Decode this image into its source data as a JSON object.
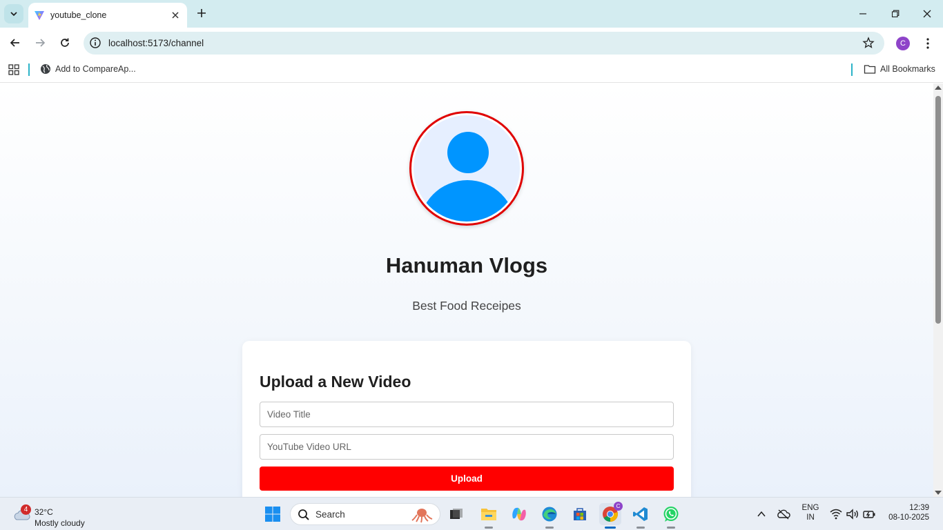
{
  "browser": {
    "tab_title": "youtube_clone",
    "url": "localhost:5173/channel",
    "profile_initial": "C",
    "bookmark_item": "Add to CompareAp...",
    "all_bookmarks": "All Bookmarks"
  },
  "channel": {
    "name": "Hanuman Vlogs",
    "description": "Best Food Receipes"
  },
  "upload_form": {
    "heading": "Upload a New Video",
    "title_placeholder": "Video Title",
    "url_placeholder": "YouTube Video URL",
    "button_label": "Upload"
  },
  "taskbar": {
    "weather_badge": "4",
    "temperature": "32°C",
    "condition": "Mostly cloudy",
    "search_label": "Search",
    "language_top": "ENG",
    "language_bottom": "IN",
    "time": "12:39",
    "date": "08-10-2025",
    "chrome_badge": "C"
  },
  "colors": {
    "accent": "#ff0000",
    "avatar_blue": "#0095ff",
    "avatar_border": "#e00000"
  }
}
